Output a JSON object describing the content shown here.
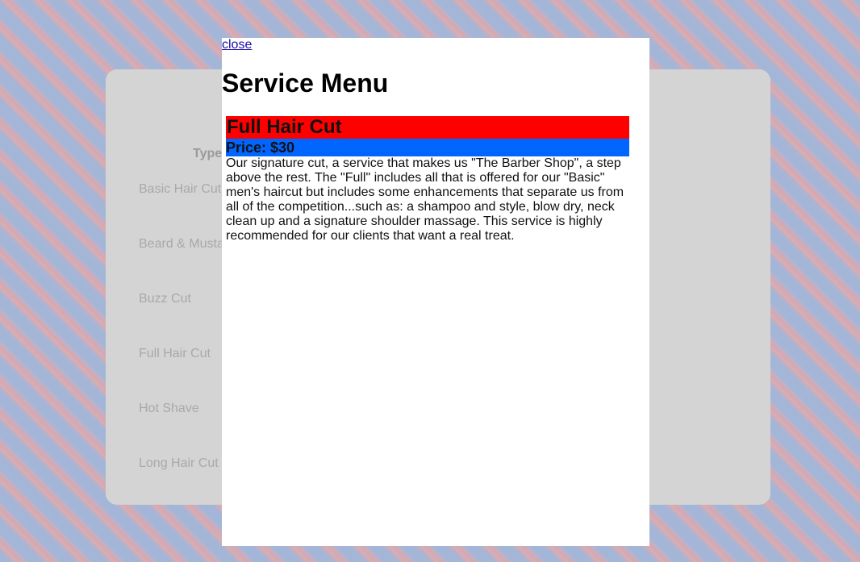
{
  "page": {
    "type_header": "Type",
    "services": [
      "Basic Hair Cut",
      "Beard & Musta",
      "Buzz Cut",
      "Full Hair Cut",
      "Hot Shave",
      "Long Hair Cut"
    ]
  },
  "modal": {
    "close_label": "close",
    "title": "Service Menu",
    "service_name": "Full Hair Cut",
    "price": "Price: $30",
    "description": "Our signature cut, a service that makes us \"The Barber Shop\", a step above the rest. The \"Full\" includes all that is offered for our \"Basic\" men's haircut but includes some enhancements that separate us from all of the competition...such as: a shampoo and style, blow dry, neck clean up and a signature shoulder massage. This service is highly recommended for our clients that want a real treat."
  },
  "colors": {
    "service_title_bg": "#ff0000",
    "price_bg": "#0066ff",
    "card_bg": "#d4d4d4",
    "link": "#1a0dab"
  }
}
